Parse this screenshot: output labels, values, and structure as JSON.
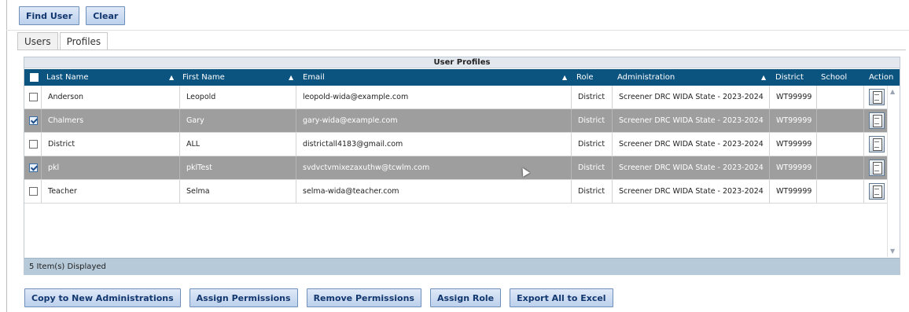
{
  "toolbar": {
    "find_user": "Find User",
    "clear": "Clear"
  },
  "tabs": [
    {
      "label": "Users",
      "active": false
    },
    {
      "label": "Profiles",
      "active": true
    }
  ],
  "grid": {
    "title": "User Profiles",
    "columns": [
      "Last Name",
      "First Name",
      "Email",
      "Role",
      "Administration",
      "District",
      "School",
      "Action"
    ],
    "sort_indicator": "▲",
    "rows": [
      {
        "last": "Anderson",
        "first": "Leopold",
        "email": "leopold-wida@example.com",
        "role": "District",
        "admin": "Screener DRC WIDA State - 2023-2024",
        "district": "WT99999",
        "school": "",
        "selected": false
      },
      {
        "last": "Chalmers",
        "first": "Gary",
        "email": "gary-wida@example.com",
        "role": "District",
        "admin": "Screener DRC WIDA State - 2023-2024",
        "district": "WT99999",
        "school": "",
        "selected": true
      },
      {
        "last": "District",
        "first": "ALL",
        "email": "districtall4183@gmail.com",
        "role": "District",
        "admin": "Screener DRC WIDA State - 2023-2024",
        "district": "WT99999",
        "school": "",
        "selected": false
      },
      {
        "last": "pkl",
        "first": "pklTest",
        "email": "svdvctvmixezaxuthw@tcwlm.com",
        "role": "District",
        "admin": "Screener DRC WIDA State - 2023-2024",
        "district": "WT99999",
        "school": "",
        "selected": true
      },
      {
        "last": "Teacher",
        "first": "Selma",
        "email": "selma-wida@teacher.com",
        "role": "District",
        "admin": "Screener DRC WIDA State - 2023-2024",
        "district": "WT99999",
        "school": "",
        "selected": false
      }
    ],
    "footer": "5 Item(s) Displayed"
  },
  "actions": {
    "copy": "Copy to New Administrations",
    "assign_permissions": "Assign Permissions",
    "remove_permissions": "Remove Permissions",
    "assign_role": "Assign Role",
    "export": "Export All to Excel"
  },
  "colors": {
    "header": "#0c5480",
    "selected_row": "#9e9e9e",
    "footer": "#b7cad9",
    "button": "#bcd0ec"
  },
  "icons": {
    "action": "clipboard-icon",
    "scroll_up": "chevron-up-icon",
    "scroll_down": "chevron-down-icon"
  }
}
